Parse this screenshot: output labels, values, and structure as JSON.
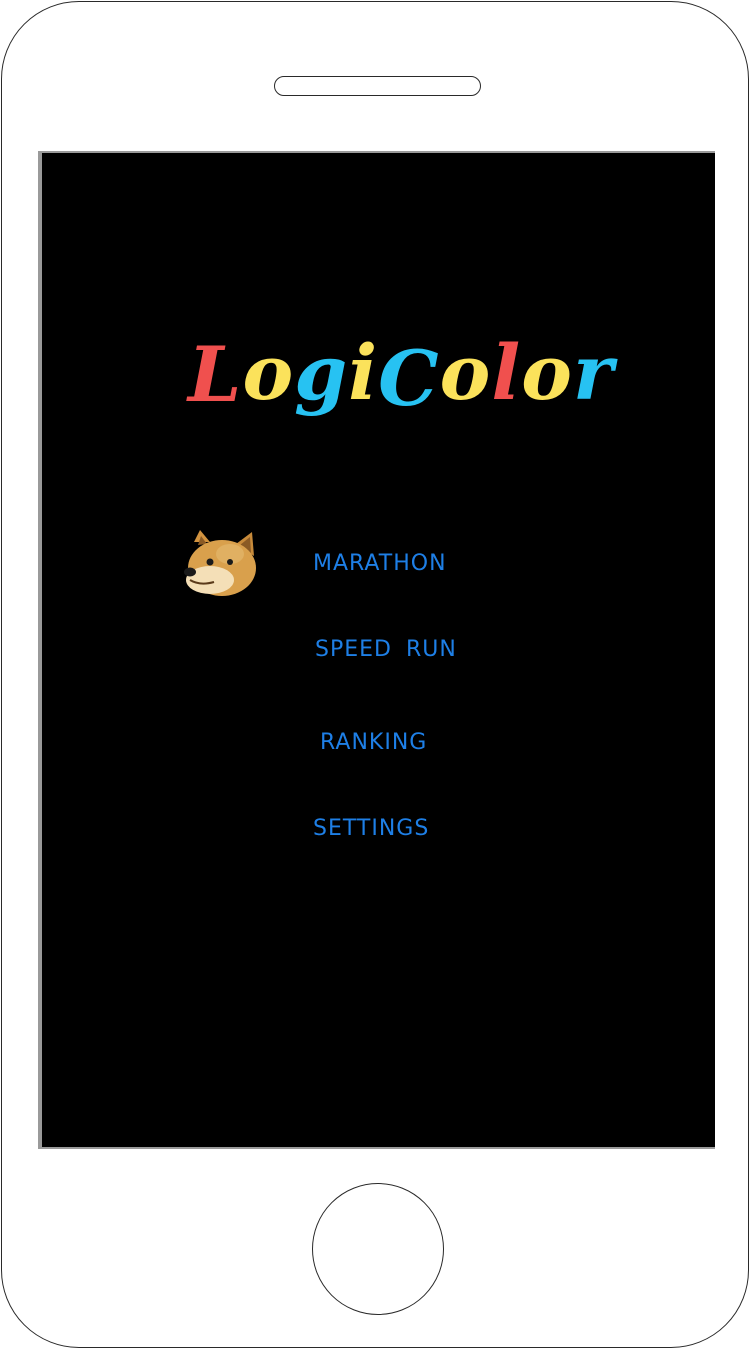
{
  "app": {
    "logo_letters": [
      {
        "char": "L",
        "color": "#f0504e"
      },
      {
        "char": "o",
        "color": "#fbe25b"
      },
      {
        "char": "g",
        "color": "#27c2f2"
      },
      {
        "char": "i",
        "color": "#fbe25b"
      },
      {
        "char": "C",
        "color": "#27c2f2"
      },
      {
        "char": "o",
        "color": "#fbe25b"
      },
      {
        "char": "l",
        "color": "#f0504e"
      },
      {
        "char": "o",
        "color": "#fbe25b"
      },
      {
        "char": "r",
        "color": "#27c2f2"
      }
    ]
  },
  "menu": {
    "accent_color": "#1e7fe6",
    "items": [
      {
        "label": "MARATHON",
        "selected": true
      },
      {
        "label": "SPEED RUN",
        "selected": false
      },
      {
        "label": "RANKING",
        "selected": false
      },
      {
        "label": "SETTINGS",
        "selected": false
      }
    ],
    "selector_icon": "doge-icon"
  },
  "colors": {
    "screen_bg": "#000000",
    "device_body": "#ffffff",
    "device_outline": "#2a2a2a"
  }
}
